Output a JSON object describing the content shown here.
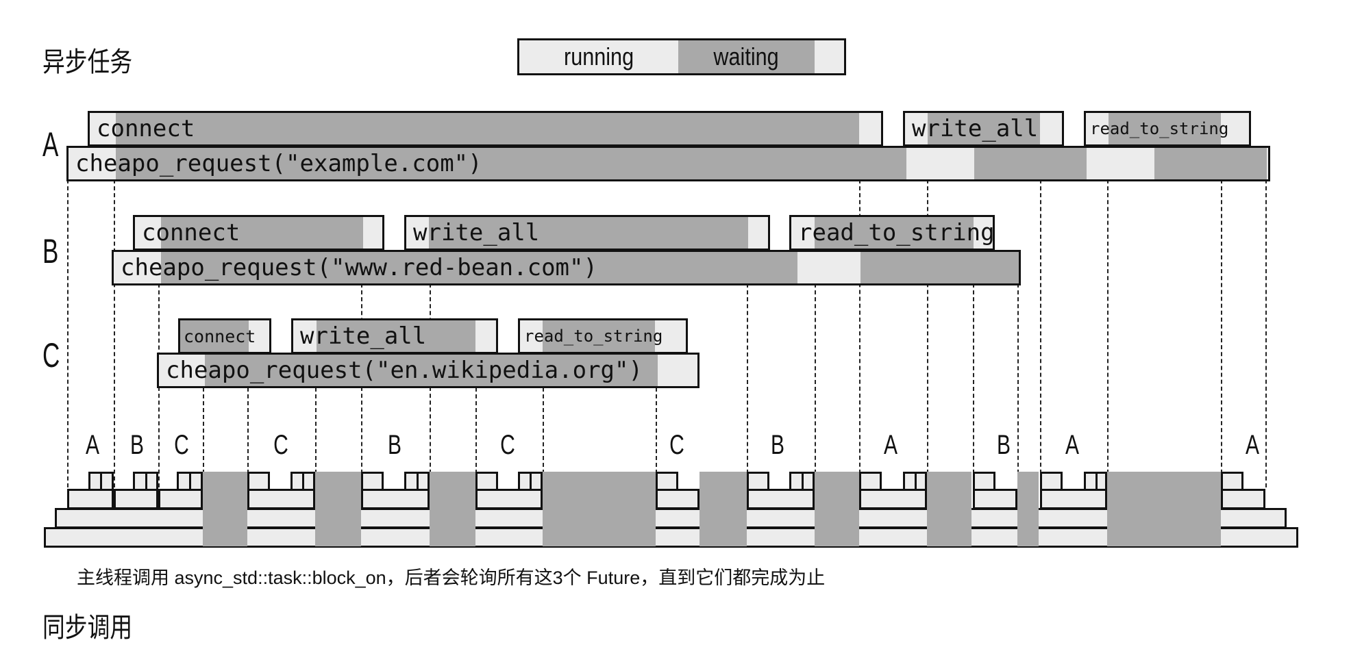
{
  "title": "异步任务",
  "legend": {
    "running": "running",
    "waiting": "waiting"
  },
  "rows": {
    "a": {
      "label": "A",
      "request": "cheapo_request(\"example.com\")",
      "connect": "connect",
      "write_all": "write_all",
      "read_to_string": "read_to_string"
    },
    "b": {
      "label": "B",
      "request": "cheapo_request(\"www.red-bean.com\")",
      "connect": "connect",
      "write_all": "write_all",
      "read_to_string": "read_to_string"
    },
    "c": {
      "label": "C",
      "request": "cheapo_request(\"en.wikipedia.org\")",
      "connect": "connect",
      "write_all": "write_all",
      "read_to_string": "read_to_string"
    }
  },
  "timeline_slots": [
    "A",
    "B",
    "C",
    "C",
    "B",
    "C",
    "C",
    "B",
    "A",
    "B",
    "A",
    "A"
  ],
  "caption": "主线程调用 async_std::task::block_on，后者会轮询所有这3个 Future，直到它们都完成为止",
  "footer_title": "同步调用"
}
